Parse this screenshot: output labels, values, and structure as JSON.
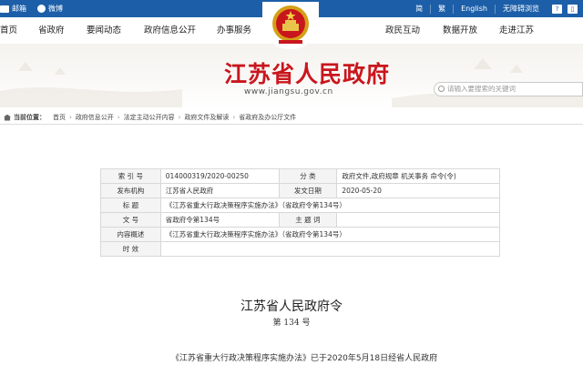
{
  "topbar": {
    "mail": "邮箱",
    "weibo": "微博",
    "simplified": "简",
    "traditional": "繁",
    "english": "English",
    "accessible": "无障碍浏览",
    "extra_icon_text": "?"
  },
  "nav": {
    "items": [
      "首页",
      "省政府",
      "要闻动态",
      "政府信息公开",
      "办事服务",
      "政民互动",
      "数据开放",
      "走进江苏"
    ]
  },
  "banner": {
    "title": "江苏省人民政府",
    "url": "www.jiangsu.gov.cn",
    "search_placeholder": "请输入要搜索的关键词"
  },
  "breadcrumb": {
    "label": "当前位置：",
    "items": [
      "首页",
      "政府信息公开",
      "法定主动公开内容",
      "政府文件及解读",
      "省政府及办公厅文件"
    ]
  },
  "info": {
    "index_label": "索  引  号",
    "index_value": "014000319/2020-00250",
    "category_label": "分      类",
    "category_value": "政府文件,政府规章 机关事务 命令(令)",
    "publisher_label": "发布机构",
    "publisher_value": "江苏省人民政府",
    "date_label": "发文日期",
    "date_value": "2020-05-20",
    "title_label": "标      题",
    "title_value": "《江苏省重大行政决策程序实施办法》（省政府令第134号）",
    "docno_label": "文      号",
    "docno_value": "省政府令第134号",
    "subject_label": "主 题 词",
    "subject_value": "",
    "summary_label": "内容概述",
    "summary_value": "《江苏省重大行政决策程序实施办法》（省政府令第134号）",
    "validity_label": "时      效",
    "validity_value": ""
  },
  "article": {
    "title": "江苏省人民政府令",
    "number": "第 134 号",
    "first_line": "《江苏省重大行政决策程序实施办法》已于2020年5月18日经省人民政府"
  },
  "colors": {
    "topbar": "#1c5fa8",
    "title_red": "#c9161d"
  }
}
